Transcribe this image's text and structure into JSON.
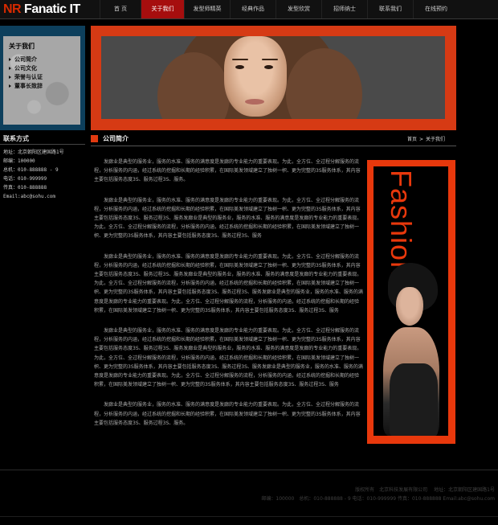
{
  "header": {
    "logo_nr": "NR",
    "logo_rest": " Fanatic IT",
    "nav": [
      {
        "label": "首 页"
      },
      {
        "label": "关于我们"
      },
      {
        "label": "发型师精英"
      },
      {
        "label": "经典作品"
      },
      {
        "label": "发型欣赏"
      },
      {
        "label": "招师纳士"
      },
      {
        "label": "联系我们"
      },
      {
        "label": "在线预约"
      }
    ],
    "active_nav": "关于我们"
  },
  "sidebar": {
    "about_title": "关于我们",
    "about_items": [
      {
        "label": "公司简介"
      },
      {
        "label": "公司文化"
      },
      {
        "label": "荣誉与认证"
      },
      {
        "label": "董事长致辞"
      }
    ],
    "contact_title": "联系方式",
    "contact_items": [
      "地址：北京朝阳区建国路1号",
      "邮编：100000",
      "总机：010-888888 - 9",
      "电话：010-999999",
      "传真：010-888888",
      "Email:abc@sohu.com"
    ]
  },
  "section": {
    "title": "公司简介",
    "breadcrumb_home": "首页",
    "breadcrumb_sep": ">",
    "breadcrumb_current": "关于我们"
  },
  "article": [
    "发廊业是典型的服务业，服务的水准、服务的满意度是发廊的专业能力的重要表现。为此，全方位、全过程分解服务的流程，分析服务的内涵，经过系统的挖掘和长期的经验积累，在国际美发领域建立了独树一帜、更为完整的3S服务体系，其内容主要包括服务态度3S、服务过程3S、服务。",
    "发廊业是典型的服务业，服务的水准、服务的满意度是发廊的专业能力的重要表现。为此，全方位、全过程分解服务的流程，分析服务的内涵，经过系统的挖掘和长期的经验积累，在国际美发领域建立了独树一帜、更为完整的3S服务体系，其内容主要包括服务态度3S、服务过程3S、服务发廊业是典型的服务业，服务的水准、服务的满意度是发廊的专业能力的重要表现。为此，全方位、全过程分解服务的流程，分析服务的内涵，经过系统的挖掘和长期的经验积累，在国际美发领域建立了独树一帜、更为完整的3S服务体系，其内容主要包括服务态度3S、服务过程3S、服务",
    "发廊业是典型的服务业，服务的水准、服务的满意度是发廊的专业能力的重要表现。为此，全方位、全过程分解服务的流程，分析服务的内涵，经过系统的挖掘和长期的经验积累，在国际美发领域建立了独树一帜、更为完整的3S服务体系，其内容主要包括服务态度3S、服务过程3S、服务发廊业是典型的服务业，服务的水准、服务的满意度是发廊的专业能力的重要表现。为此，全方位、全过程分解服务的流程，分析服务的内涵，经过系统的挖掘和长期的经验积累，在国际美发领域建立了独树一帜、更为完整的3S服务体系，其内容主要包括服务态度3S、服务过程3S、服务发廊业是典型的服务业，服务的水准、服务的满意度是发廊的专业能力的重要表现。为此，全方位、全过程分解服务的流程，分析服务的内涵，经过系统的挖掘和长期的经验积累，在国际美发领域建立了独树一帜、更为完整的3S服务体系，其内容主要包括服务态度3S、服务过程3S、服务",
    "发廊业是典型的服务业，服务的水准、服务的满意度是发廊的专业能力的重要表现。为此，全方位、全过程分解服务的流程，分析服务的内涵，经过系统的挖掘和长期的经验积累，在国际美发领域建立了独树一帜、更为完整的3S服务体系，其内容主要包括服务态度3S、服务过程3S、服务发廊业是典型的服务业，服务的水准、服务的满意度是发廊的专业能力的重要表现。为此，全方位、全过程分解服务的流程，分析服务的内涵，经过系统的挖掘和长期的经验积累，在国际美发领域建立了独树一帜、更为完整的3S服务体系，其内容主要包括服务态度3S、服务过程3S、服务发廊业是典型的服务业，服务的水准、服务的满意度是发廊的专业能力的重要表现。为此，全方位、全过程分解服务的流程，分析服务的内涵，经过系统的挖掘和长期的经验积累，在国际美发领域建立了独树一帜、更为完整的3S服务体系，其内容主要包括服务态度3S、服务过程3S、服务",
    "发廊业是典型的服务业，服务的水准、服务的满意度是发廊的专业能力的重要表现。为此，全方位、全过程分解服务的流程，分析服务的内涵，经过系统的挖掘和长期的经验积累，在国际美发领域建立了独树一帜、更为完整的3S服务体系，其内容主要包括服务态度3S、服务过程3S、服务。"
  ],
  "fashion_word": "Fashion",
  "footer": {
    "line1_copyright": "版权所有　北京科技发展有限公司",
    "line1_address": "地址：北京朝阳区建国路1号",
    "line2": "邮编：100000　总机：010-888888 - 9 电话：010-999999 传真：010-888888 Email:abc@sohu.com"
  },
  "colors": {
    "accent": "#e8380c",
    "nav_active": "#a60e0e",
    "sidebar_box": "#0d3f5c"
  }
}
